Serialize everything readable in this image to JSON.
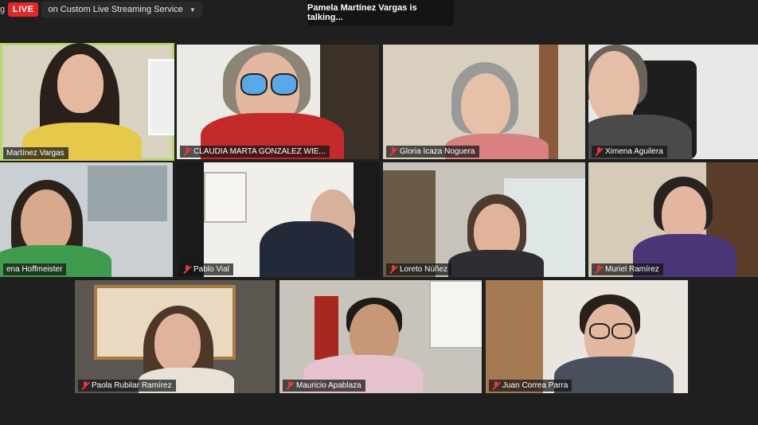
{
  "top_bar": {
    "edge_text": "g",
    "live_label": "LIVE",
    "stream_target": "on Custom Live Streaming Service",
    "talking_status": "Pamela Martínez Vargas  is talking..."
  },
  "tiles": [
    {
      "name": "Martínez Vargas",
      "muted": false,
      "active": true
    },
    {
      "name": "CLAUDIA MARTA GONZALEZ WIE...",
      "muted": true
    },
    {
      "name": "Gloria Icaza Noguera",
      "muted": true
    },
    {
      "name": "Ximena Aguilera",
      "muted": true
    },
    {
      "name": "ena Hoffmeister",
      "muted": false
    },
    {
      "name": "Pablo Vial",
      "muted": true
    },
    {
      "name": "Loreto Núñez",
      "muted": true
    },
    {
      "name": "Muriel Ramírez",
      "muted": true
    },
    {
      "name": "Paola Rubilar Ramírez",
      "muted": true
    },
    {
      "name": "Mauricio Apablaza",
      "muted": true
    },
    {
      "name": "Juan Correa Parra",
      "muted": true
    }
  ],
  "colors": {
    "live": "#e02828",
    "active_speaker_border": "#b8d86a",
    "muted_icon": "#e23b3b"
  }
}
